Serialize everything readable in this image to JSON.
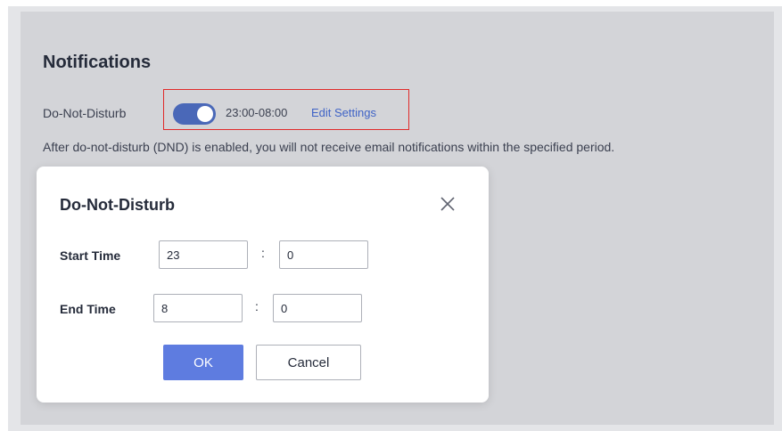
{
  "page": {
    "title": "Notifications",
    "dnd_label": "Do-Not-Disturb",
    "toggle_on": true,
    "time_range": "23:00-08:00",
    "edit_link": "Edit Settings",
    "description": "After do-not-disturb (DND) is enabled, you will not receive email notifications within the specified period."
  },
  "dialog": {
    "title": "Do-Not-Disturb",
    "start_label": "Start Time",
    "start_hour": "23",
    "start_minute": "0",
    "end_label": "End Time",
    "end_hour": "8",
    "end_minute": "0",
    "separator": ":",
    "ok_label": "OK",
    "cancel_label": "Cancel"
  },
  "colors": {
    "accent": "#5e7ce0",
    "toggle": "#4a68b8",
    "link": "#3f63c6",
    "highlight": "#e02a2a"
  },
  "icons": {
    "close": "close-icon"
  }
}
